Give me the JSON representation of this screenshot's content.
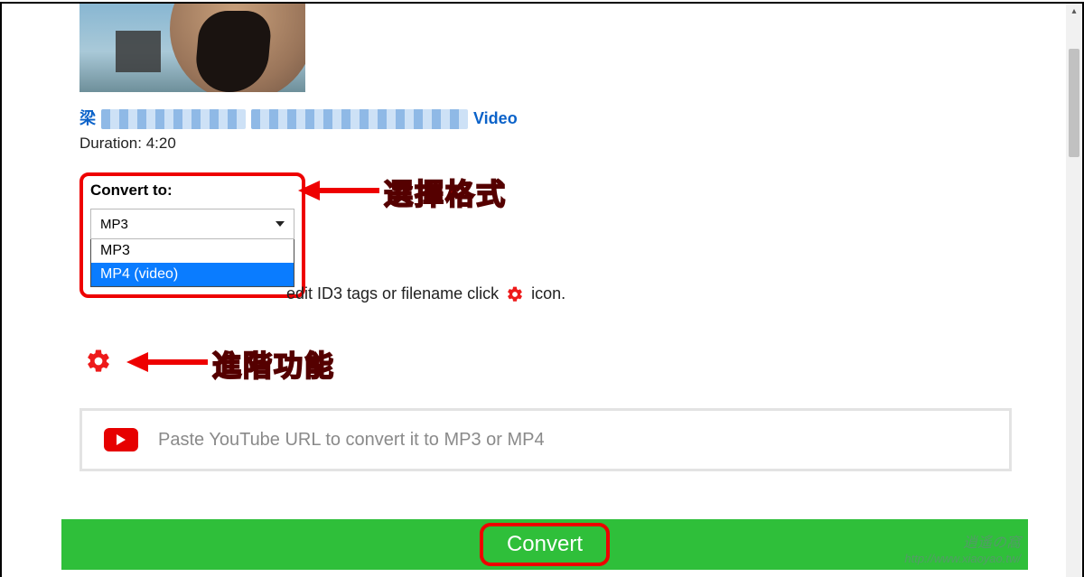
{
  "video": {
    "title_prefix": "梁",
    "title_suffix": "Video",
    "duration_label": "Duration: 4:20"
  },
  "convert": {
    "label": "Convert to:",
    "selected": "MP3",
    "options": [
      "MP3",
      "MP4 (video)"
    ],
    "button": "Convert"
  },
  "hint": "edit ID3 tags or filename click",
  "hint_tail": "icon.",
  "annotations": {
    "format": "選擇格式",
    "advanced": "進階功能"
  },
  "info_placeholder": "Paste YouTube URL to convert it to MP3 or MP4",
  "watermark": {
    "line1": "逍遙の窩",
    "line2": "http://www.xiaoyao.tw/"
  }
}
